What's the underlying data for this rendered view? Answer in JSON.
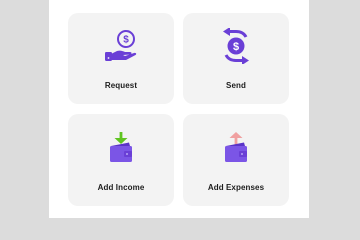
{
  "colors": {
    "background": "#dcdcdc",
    "panel": "#ffffff",
    "card": "#f3f3f3",
    "purple": "#6a3fd6",
    "wallet": "#7b55e6",
    "arrow_in": "#5fc421",
    "arrow_out": "#f0a0a0",
    "text": "#1d1d1d"
  },
  "actions": [
    {
      "label": "Request",
      "icon": "hand-dollar-icon"
    },
    {
      "label": "Send",
      "icon": "exchange-dollar-icon"
    },
    {
      "label": "Add Income",
      "icon": "wallet-in-icon"
    },
    {
      "label": "Add Expenses",
      "icon": "wallet-out-icon"
    }
  ]
}
